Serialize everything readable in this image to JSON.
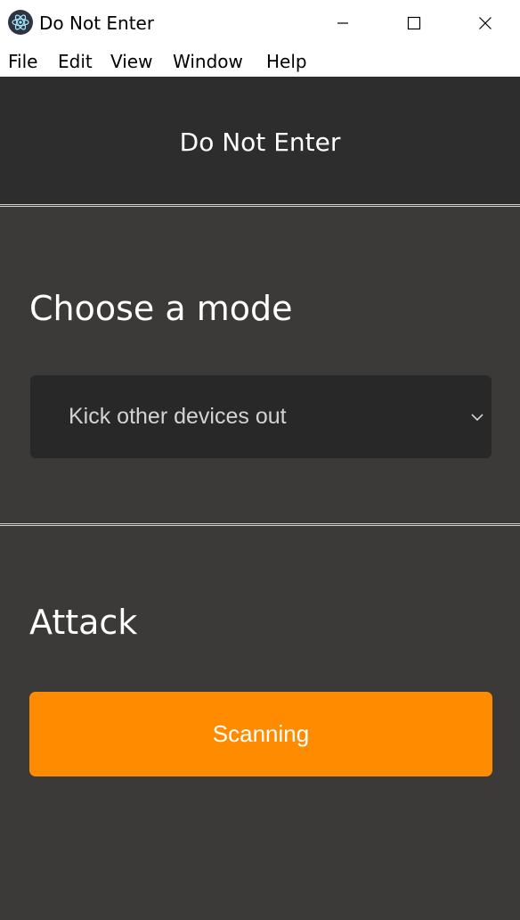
{
  "window": {
    "title": "Do Not Enter"
  },
  "menu": {
    "items": [
      "File",
      "Edit",
      "View",
      "Window",
      "Help"
    ]
  },
  "header": {
    "title": "Do Not Enter"
  },
  "mode_section": {
    "heading": "Choose a mode",
    "selected_value": "Kick other devices out"
  },
  "attack_section": {
    "heading": "Attack",
    "button_label": "Scanning"
  },
  "colors": {
    "accent": "#ff8c00",
    "header_bg": "#2d2d2d",
    "body_bg": "#3c3a39",
    "select_bg": "#282828"
  },
  "icons": [
    "app-icon",
    "minimize-icon",
    "maximize-icon",
    "close-icon",
    "chevron-down-icon"
  ]
}
